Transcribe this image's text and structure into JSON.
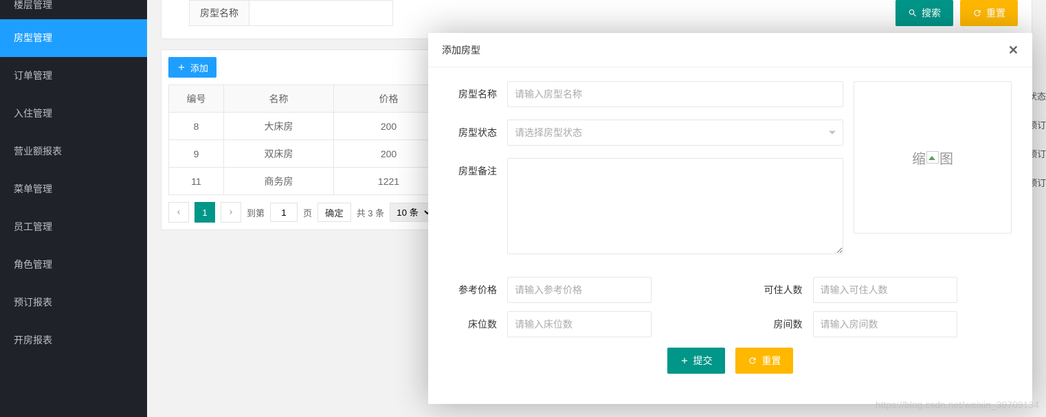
{
  "sidebar": {
    "items": [
      {
        "label": "楼层管理"
      },
      {
        "label": "房型管理"
      },
      {
        "label": "订单管理"
      },
      {
        "label": "入住管理"
      },
      {
        "label": "营业额报表"
      },
      {
        "label": "菜单管理"
      },
      {
        "label": "员工管理"
      },
      {
        "label": "角色管理"
      },
      {
        "label": "预订报表"
      },
      {
        "label": "开房报表"
      }
    ],
    "active_index": 1
  },
  "search": {
    "label": "房型名称",
    "search_btn": "搜索",
    "reset_btn": "重置"
  },
  "toolbar": {
    "add_btn": "添加"
  },
  "table": {
    "columns": [
      "编号",
      "名称",
      "价格"
    ],
    "rows": [
      {
        "id": "8",
        "name": "大床房",
        "price": "200"
      },
      {
        "id": "9",
        "name": "双床房",
        "price": "200"
      },
      {
        "id": "11",
        "name": "商务房",
        "price": "1221"
      }
    ],
    "hidden_col_header": "状态",
    "hidden_col_cell": "预订"
  },
  "pagination": {
    "current": "1",
    "goto_label": "到第",
    "page_suffix": "页",
    "goto_value": "1",
    "confirm": "确定",
    "total": "共 3 条",
    "page_size": "10 条"
  },
  "modal": {
    "title": "添加房型",
    "fields": {
      "name_label": "房型名称",
      "name_placeholder": "请输入房型名称",
      "status_label": "房型状态",
      "status_placeholder": "请选择房型状态",
      "remark_label": "房型备注",
      "price_label": "参考价格",
      "price_placeholder": "请输入参考价格",
      "capacity_label": "可住人数",
      "capacity_placeholder": "请输入可住人数",
      "beds_label": "床位数",
      "beds_placeholder": "请输入床位数",
      "rooms_label": "房间数",
      "rooms_placeholder": "请输入房间数"
    },
    "thumbnail_prefix": "缩",
    "thumbnail_suffix": "图",
    "submit_btn": "提交",
    "reset_btn": "重置"
  },
  "watermark": "https://blog.csdn.net/weixin_39709134"
}
